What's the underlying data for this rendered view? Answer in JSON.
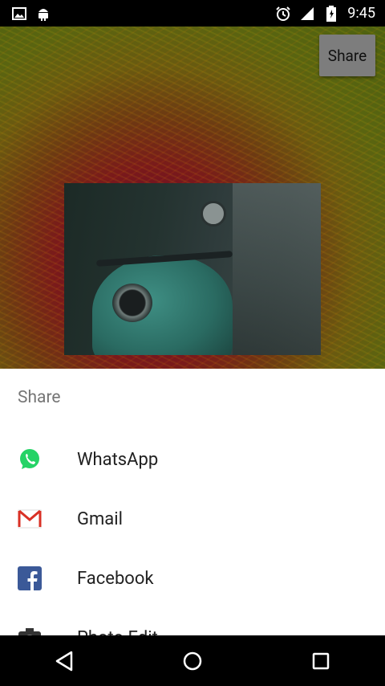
{
  "status_bar": {
    "time": "9:45",
    "icons": [
      "gallery-icon",
      "android-icon",
      "alarm-icon",
      "signal-icon",
      "battery-icon"
    ]
  },
  "app": {
    "share_button_label": "Share"
  },
  "share_sheet": {
    "title": "Share",
    "items": [
      {
        "label": "WhatsApp",
        "icon": "whatsapp-icon"
      },
      {
        "label": "Gmail",
        "icon": "gmail-icon"
      },
      {
        "label": "Facebook",
        "icon": "facebook-icon"
      },
      {
        "label": "Photo Edit",
        "icon": "camera-icon"
      }
    ]
  },
  "nav_bar": {
    "buttons": [
      "back-icon",
      "home-icon",
      "recents-icon"
    ]
  },
  "colors": {
    "whatsapp": "#25D366",
    "gmail_red": "#D93025",
    "facebook": "#3B5998"
  }
}
